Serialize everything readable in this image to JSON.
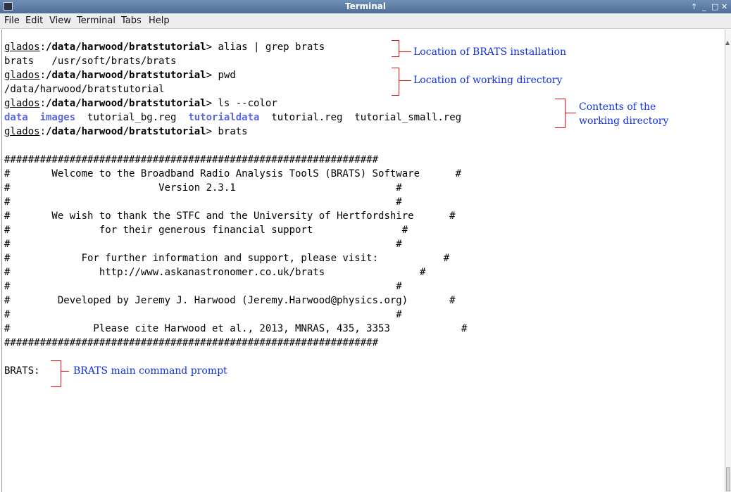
{
  "window": {
    "title": "Terminal",
    "controls": [
      "↑",
      "_",
      "□",
      "✕"
    ]
  },
  "menubar": {
    "items": [
      "File",
      "Edit",
      "View",
      "Terminal",
      "Tabs",
      "Help"
    ]
  },
  "terminal": {
    "prompt_host": "glados",
    "prompt_path": "/data/harwood/bratstutorial",
    "prompt_char": ">",
    "commands": {
      "alias": " alias | grep brats",
      "pwd": " pwd",
      "ls": " ls --color",
      "brats": " brats"
    },
    "alias_output": "brats   /usr/soft/brats/brats",
    "pwd_output": "/data/harwood/bratstutorial",
    "ls_output": {
      "dir1": "data",
      "dir2": "images",
      "file1": "tutorial_bg.reg",
      "dir3": "tutorialdata",
      "file2": "tutorial.reg",
      "file3": "tutorial_small.reg"
    },
    "banner": [
      "###############################################################",
      "#       Welcome to the Broadband Radio Analysis ToolS (BRATS) Software      #",
      "#                         Version 2.3.1                           #",
      "#                                                                 #",
      "#       We wish to thank the STFC and the University of Hertfordshire      #",
      "#               for their generous financial support               #",
      "#                                                                 #",
      "#            For further information and support, please visit:           #",
      "#               http://www.askanastronomer.co.uk/brats                #",
      "#                                                                 #",
      "#        Developed by Jeremy J. Harwood (Jeremy.Harwood@physics.org)       #",
      "#                                                                 #",
      "#              Please cite Harwood et al., 2013, MNRAS, 435, 3353            #",
      "###############################################################"
    ],
    "brats_prompt": "BRATS:"
  },
  "annotations": {
    "installation": "Location of BRATS installation",
    "working_dir": "Location of working directory",
    "contents_line1": "Contents of the",
    "contents_line2": "working directory",
    "main_prompt": "BRATS main command prompt"
  },
  "colors": {
    "directory": "#5a67e6",
    "annotation_text": "#1030e0",
    "annotation_bracket": "#e51515",
    "titlebar": "#5f7fa8"
  }
}
